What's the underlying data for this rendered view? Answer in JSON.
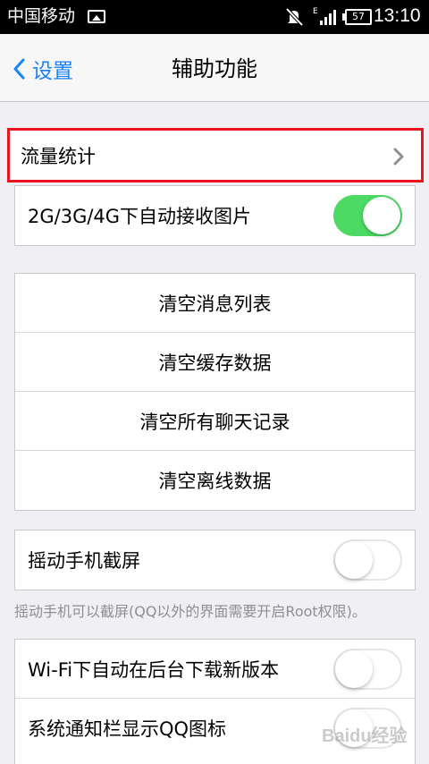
{
  "status_bar": {
    "carrier": "中国移动",
    "battery": "57",
    "time": "13:10",
    "signal_label": "E"
  },
  "nav": {
    "back_label": "设置",
    "title": "辅助功能"
  },
  "traffic_row": {
    "label": "流量统计"
  },
  "auto_receive_row": {
    "label": "2G/3G/4G下自动接收图片",
    "toggle_on": true
  },
  "clear_group": {
    "items": [
      {
        "label": "清空消息列表"
      },
      {
        "label": "清空缓存数据"
      },
      {
        "label": "清空所有聊天记录"
      },
      {
        "label": "清空离线数据"
      }
    ]
  },
  "shake_row": {
    "label": "摇动手机截屏",
    "toggle_on": false
  },
  "shake_footnote": "摇动手机可以截屏(QQ以外的界面需要开启Root权限)。",
  "bottom_group": {
    "items": [
      {
        "label": "Wi-Fi下自动在后台下载新版本",
        "toggle_on": false
      },
      {
        "label": "系统通知栏显示QQ图标",
        "toggle_on": false
      }
    ]
  },
  "watermark": "Baidu经验",
  "colors": {
    "accent": "#1a82fb",
    "toggle_on": "#4cd964",
    "highlight_border": "#e8141e",
    "background": "#efeff4"
  }
}
